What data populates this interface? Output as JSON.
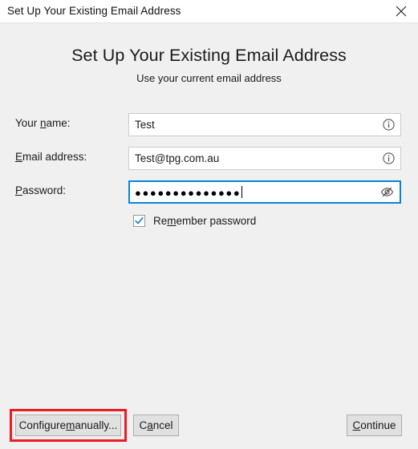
{
  "window": {
    "title": "Set Up Your Existing Email Address",
    "close_icon": "close-icon"
  },
  "content": {
    "heading": "Set Up Your Existing Email Address",
    "subheading": "Use your current email address"
  },
  "form": {
    "fields": [
      {
        "label_before": "Your ",
        "label_key": "n",
        "label_after": "ame:",
        "value": "Test",
        "icon": "info-icon",
        "focused": false
      },
      {
        "label_before": "",
        "label_key": "E",
        "label_after": "mail address:",
        "value": "Test@tpg.com.au",
        "icon": "info-icon",
        "focused": false
      },
      {
        "label_before": "",
        "label_key": "P",
        "label_after": "assword:",
        "value": "●●●●●●●●●●●●●●",
        "icon": "eye-slash-icon",
        "focused": true
      }
    ],
    "remember": {
      "label_before": "Re",
      "label_key": "m",
      "label_after": "ember password",
      "checked": true,
      "check_icon": "checkmark-icon"
    }
  },
  "buttons": {
    "configure": {
      "before": "Configure ",
      "key": "m",
      "after": "anually..."
    },
    "cancel": {
      "before": "C",
      "key": "a",
      "after": "ncel"
    },
    "continue": {
      "before": "",
      "key": "C",
      "after": "ontinue"
    }
  },
  "annotation": {
    "target": "configure-manually-button",
    "color": "#ed1c24"
  },
  "colors": {
    "background": "#f0f0f0",
    "titlebar": "#ffffff",
    "field_border": "#cccccc",
    "focus_border": "#0a84d8",
    "button_face": "#e1e1e1",
    "button_border": "#adadad",
    "checkmark": "#0a6ed1",
    "annotation": "#ed1c24"
  }
}
